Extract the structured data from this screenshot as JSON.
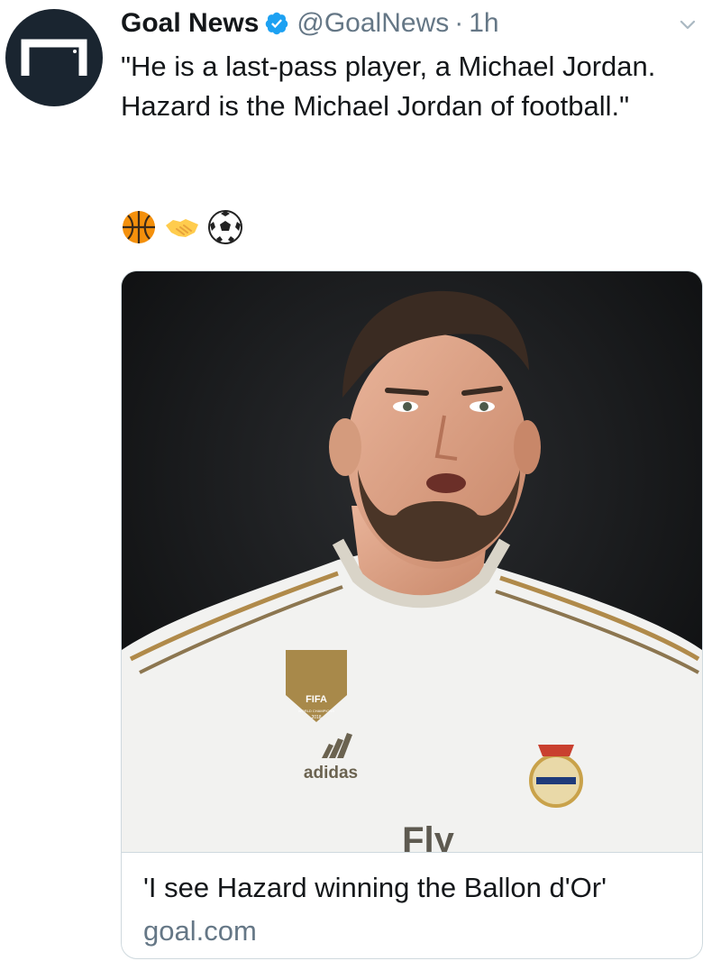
{
  "tweet": {
    "author": {
      "display_name": "Goal News",
      "handle": "@GoalNews",
      "verified": true,
      "avatar_icon": "goal-logo-icon"
    },
    "separator": "·",
    "time": "1h",
    "text": "\"He is a last-pass player, a Michael Jordan. Hazard is the Michael Jordan of football.\"",
    "emojis": [
      "basketball-icon",
      "handshake-icon",
      "soccer-ball-icon"
    ],
    "menu_icon": "chevron-down-icon"
  },
  "card": {
    "image_icon": "player-photo",
    "title": "'I see Hazard winning the Ballon d'Or'",
    "domain": "goal.com",
    "jersey": {
      "badge_text": "FIFA",
      "badge_subtext": "WORLD CHAMPIONS",
      "badge_year": "2018",
      "sponsor": "adidas",
      "shirt_text": "Fly"
    }
  },
  "colors": {
    "text": "#14171a",
    "muted": "#657786",
    "verified": "#1da1f2",
    "border": "#cfd9de",
    "avatar_bg": "#1a2530"
  }
}
